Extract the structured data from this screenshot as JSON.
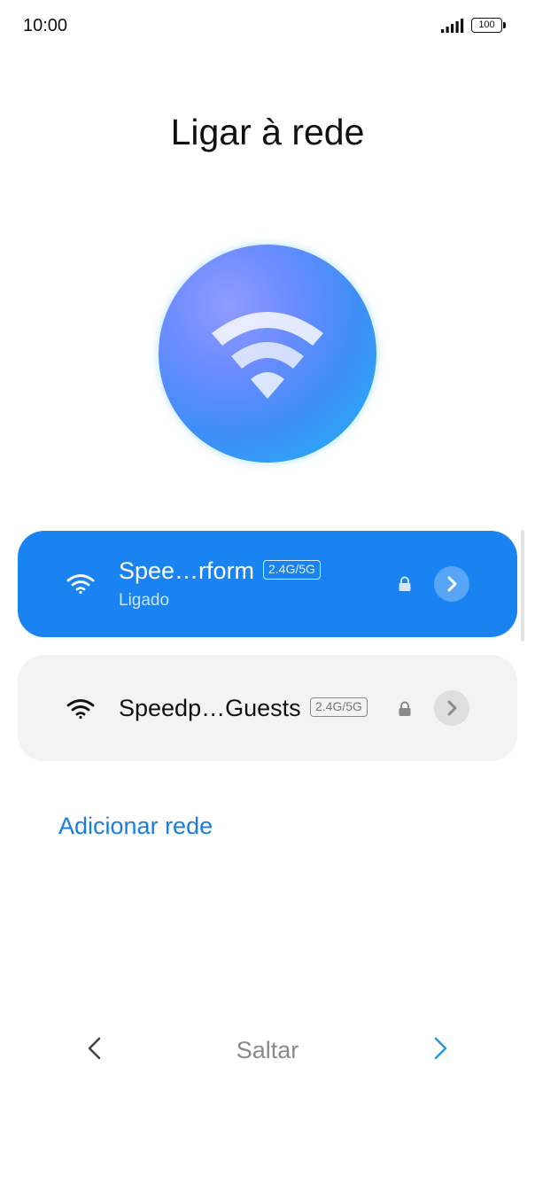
{
  "status_bar": {
    "time": "10:00",
    "battery_level": "100",
    "signal_icon": "cellular-signal-icon",
    "battery_icon": "battery-icon"
  },
  "page": {
    "title": "Ligar à rede",
    "hero_icon": "wifi-icon"
  },
  "networks": [
    {
      "name": "Spee…rform",
      "band": "2.4G/5G",
      "status": "Ligado",
      "secured": true,
      "connected": true,
      "accent_color": "#1a83f2"
    },
    {
      "name": "Speedp…Guests",
      "band": "2.4G/5G",
      "status": "",
      "secured": true,
      "connected": false,
      "accent_color": "#f3f3f3"
    }
  ],
  "add_network": {
    "label": "Adicionar rede",
    "color": "#1a7ee0"
  },
  "footer_nav": {
    "back_icon": "chevron-left-icon",
    "skip_label": "Saltar",
    "next_icon": "chevron-right-icon",
    "next_color": "#2a9ad8"
  }
}
